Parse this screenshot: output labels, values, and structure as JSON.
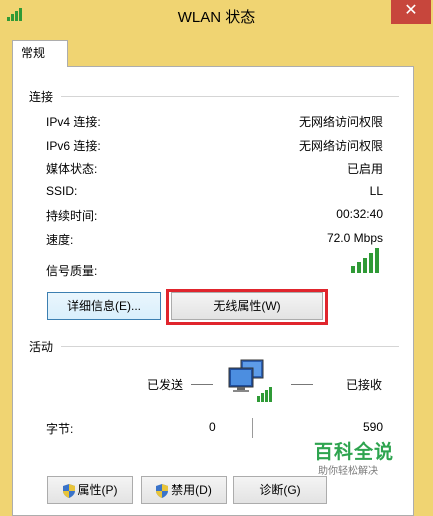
{
  "window": {
    "title": "WLAN 状态",
    "close_label": "✕"
  },
  "tabs": [
    {
      "label": "常规",
      "selected": true
    }
  ],
  "connection": {
    "section_title": "连接",
    "rows": [
      {
        "label": "IPv4 连接:",
        "value": "无网络访问权限"
      },
      {
        "label": "IPv6 连接:",
        "value": "无网络访问权限"
      },
      {
        "label": "媒体状态:",
        "value": "已启用"
      },
      {
        "label": "SSID:",
        "value": "LL"
      },
      {
        "label": "持续时间:",
        "value": "00:32:40"
      },
      {
        "label": "速度:",
        "value": "72.0 Mbps"
      }
    ],
    "signal_label": "信号质量:",
    "signal_bars": 5,
    "signal_bars_total": 5,
    "details_button": "详细信息(E)...",
    "wireless_props_button": "无线属性(W)"
  },
  "activity": {
    "section_title": "活动",
    "sent_label": "已发送",
    "received_label": "已接收",
    "bytes_label": "字节:",
    "bytes_sent": "0",
    "bytes_received": "590"
  },
  "footer": {
    "properties_button": "属性(P)",
    "disable_button": "禁用(D)",
    "diagnose_button": "诊断(G)"
  },
  "watermark": {
    "main": "百科全说",
    "sub": "助你轻松解决"
  },
  "colors": {
    "frame": "#f0d472",
    "highlight": "#e0252d",
    "signal": "#2f9a36",
    "close": "#c7463c"
  },
  "icons": [
    "wifi-signal-icon",
    "network-computers-icon",
    "shield-icon"
  ]
}
